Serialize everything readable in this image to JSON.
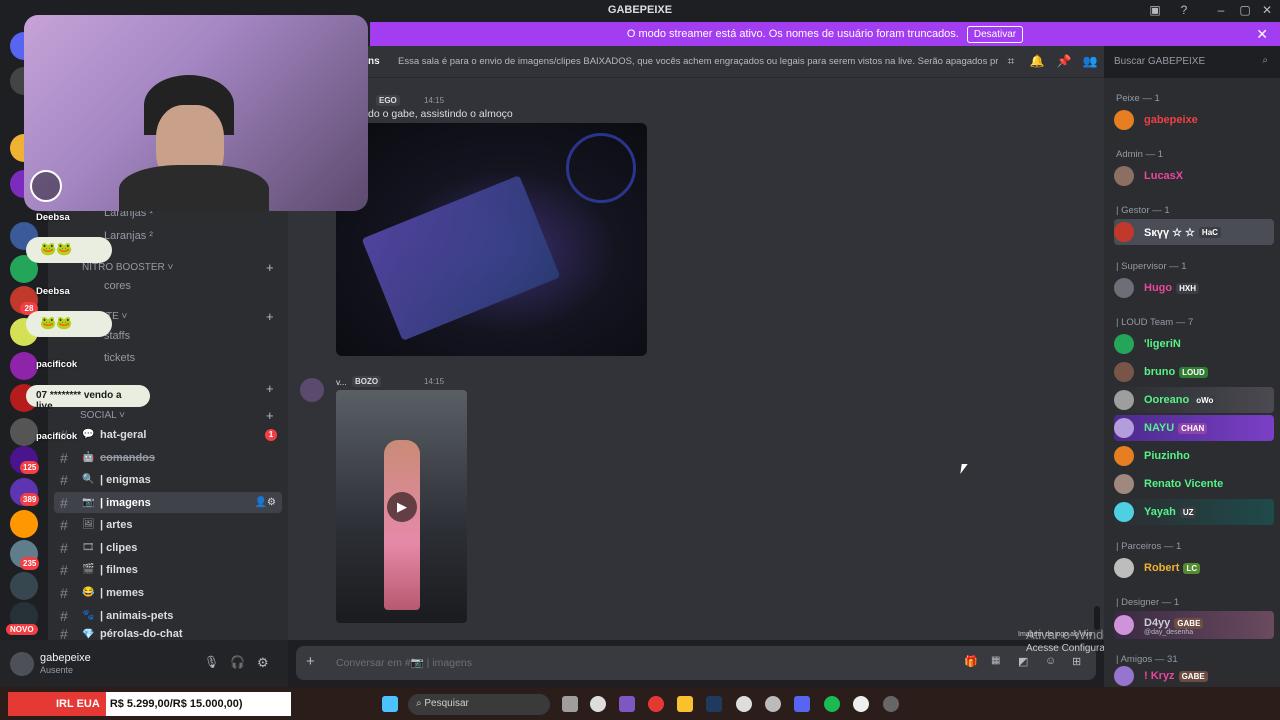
{
  "window": {
    "title": "GABEPEIXE"
  },
  "banner": {
    "text": "O modo streamer está ativo. Os nomes de usuário foram truncados.",
    "button": "Desativar"
  },
  "rail_badges": [
    "28",
    "125",
    "389",
    "235"
  ],
  "rail_new": "NOVO",
  "stream_overlay": {
    "nick1": "Deebsa",
    "nick2": "Deebsa",
    "nick3": "pacificok",
    "nick4": "pacificok",
    "popup_text": "07 ******** vendo a live"
  },
  "channels": {
    "items_top": [
      "Laranjas ¹",
      "Laranjas ²"
    ],
    "category_nitro": "NITRO BOOSTER ˅",
    "item_cores": "cores",
    "category_suporte": "TE ˅",
    "item_staffs": "staffs",
    "item_tickets": "tickets",
    "category_social": "SOCIAL ˅",
    "social_items": [
      {
        "label": "hat-geral",
        "emoji": "💬"
      },
      {
        "label": "comandos",
        "emoji": "🤖"
      },
      {
        "label": "| enigmas",
        "emoji": "🔍"
      },
      {
        "label": "| imagens",
        "emoji": "📷"
      },
      {
        "label": "| artes",
        "emoji": "🖼"
      },
      {
        "label": "| clipes",
        "emoji": "🎞"
      },
      {
        "label": "| filmes",
        "emoji": "🎬"
      },
      {
        "label": "| memes",
        "emoji": "😂"
      },
      {
        "label": "| animais-pets",
        "emoji": "🐾"
      },
      {
        "label": "pérolas-do-chat",
        "emoji": "💎"
      }
    ],
    "badge_hat_geral": "1"
  },
  "user_panel": {
    "name": "gabepeixe",
    "status": "Ausente"
  },
  "topbar": {
    "channel_name": "ns",
    "topic": "Essa sala é para o envio de imagens/clipes BAIXADOS, que vocês achem engraçados ou legais para serem vistos na live. Serão apagados prints de o...",
    "search_placeholder": "Buscar GABEPEIXE"
  },
  "messages": [
    {
      "role_tag": "EGO",
      "time": "14:15",
      "text": "do o gabe, assistindo o almoço"
    },
    {
      "author": "v...",
      "role_tag": "BOZO",
      "time": "14:15"
    }
  ],
  "input": {
    "placeholder": "Conversar em #📷 | imagens"
  },
  "members": {
    "groups": [
      {
        "label": "Peixe — 1"
      },
      {
        "label": "Admin — 1"
      },
      {
        "label": "| Gestor — 1"
      },
      {
        "label": "| Supervisor — 1"
      },
      {
        "label": "| LOUD Team — 7"
      },
      {
        "label": "| Parceiros — 1"
      },
      {
        "label": "| Designer — 1"
      },
      {
        "label": "| Amigos — 31"
      }
    ],
    "list": [
      {
        "name": "gabepeixe",
        "color": "#f23f43",
        "tag": ""
      },
      {
        "name": "LucasX",
        "color": "#eb459e",
        "tag": ""
      },
      {
        "name": "Sкүү ☆ ☆",
        "color": "#ffffff",
        "tag": "HaC"
      },
      {
        "name": "Hugo",
        "color": "#eb459e",
        "tag": "HXH"
      },
      {
        "name": "'ligeriN",
        "color": "#57f287",
        "tag": ""
      },
      {
        "name": "bruno",
        "color": "#57f287",
        "tag": "LOUD"
      },
      {
        "name": "Ooreano",
        "color": "#57f287",
        "tag": "oWo"
      },
      {
        "name": "NAYU",
        "color": "#57f287",
        "tag": "CHAN"
      },
      {
        "name": "Piuzinho",
        "color": "#57f287",
        "tag": ""
      },
      {
        "name": "Renato Vicente",
        "color": "#57f287",
        "tag": ""
      },
      {
        "name": "Yayah",
        "color": "#57f287",
        "tag": "UZ"
      },
      {
        "name": "Robert",
        "color": "#f0b232",
        "tag": "LC"
      },
      {
        "name": "D4yy",
        "color": "#c9cdd2",
        "tag": "GABE",
        "sub": "@day_desenha"
      },
      {
        "name": "! Kryz",
        "color": "#eb459e",
        "tag": "GABE"
      }
    ]
  },
  "windows_notice": {
    "title": "Ativar o Windows",
    "subtitle": "Acesse Configurações para ativar o Windows.",
    "small": "Imagem de jogo ao vivo"
  },
  "taskbar": {
    "irl_label": "IRL EUA",
    "irl_value": "R$ 5.299,00/R$ 15.000,00)",
    "search_placeholder": "Pesquisar"
  },
  "colors": {
    "banner": "#a23df2",
    "accent": "#5865f2",
    "bg": "#313338"
  }
}
